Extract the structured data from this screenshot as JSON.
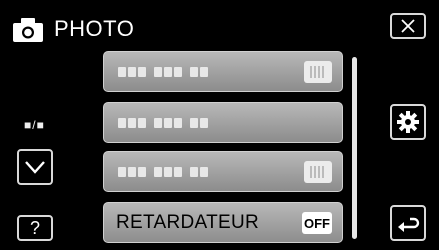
{
  "header": {
    "title": "PHOTO",
    "icon": "camera-icon"
  },
  "left_panel": {
    "page_indicator": "■/■",
    "help_label": "?"
  },
  "menu": {
    "items": [
      {
        "label": "",
        "value_icon": "setting-icon"
      },
      {
        "label": "",
        "value_icon": ""
      },
      {
        "label": "",
        "value_icon": "setting-icon"
      },
      {
        "label": "RETARDATEUR",
        "value": "OFF"
      }
    ]
  },
  "right_panel": {
    "close_icon": "close-icon",
    "settings_icon": "gear-icon",
    "back_icon": "return-icon"
  }
}
